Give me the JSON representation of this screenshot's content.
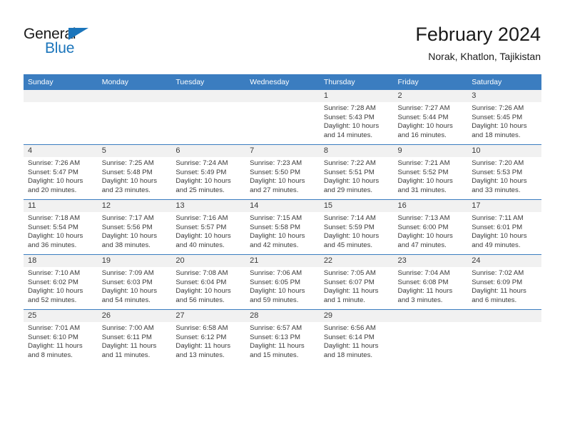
{
  "brand": {
    "name_top": "General",
    "name_bottom": "Blue",
    "triangle_icon": "triangle-icon",
    "accent_color": "#1b75bb"
  },
  "header": {
    "title": "February 2024",
    "subtitle": "Norak, Khatlon, Tajikistan"
  },
  "theme": {
    "header_blue": "#3b7dc0",
    "day_band_gray": "#f1f1f1",
    "text_color": "#3a3a3a"
  },
  "weekday_headers": [
    "Sunday",
    "Monday",
    "Tuesday",
    "Wednesday",
    "Thursday",
    "Friday",
    "Saturday"
  ],
  "weeks": [
    [
      {
        "day": "",
        "sunrise": "",
        "sunset": "",
        "daylight_line1": "",
        "daylight_line2": ""
      },
      {
        "day": "",
        "sunrise": "",
        "sunset": "",
        "daylight_line1": "",
        "daylight_line2": ""
      },
      {
        "day": "",
        "sunrise": "",
        "sunset": "",
        "daylight_line1": "",
        "daylight_line2": ""
      },
      {
        "day": "",
        "sunrise": "",
        "sunset": "",
        "daylight_line1": "",
        "daylight_line2": ""
      },
      {
        "day": "1",
        "sunrise": "Sunrise: 7:28 AM",
        "sunset": "Sunset: 5:43 PM",
        "daylight_line1": "Daylight: 10 hours",
        "daylight_line2": "and 14 minutes."
      },
      {
        "day": "2",
        "sunrise": "Sunrise: 7:27 AM",
        "sunset": "Sunset: 5:44 PM",
        "daylight_line1": "Daylight: 10 hours",
        "daylight_line2": "and 16 minutes."
      },
      {
        "day": "3",
        "sunrise": "Sunrise: 7:26 AM",
        "sunset": "Sunset: 5:45 PM",
        "daylight_line1": "Daylight: 10 hours",
        "daylight_line2": "and 18 minutes."
      }
    ],
    [
      {
        "day": "4",
        "sunrise": "Sunrise: 7:26 AM",
        "sunset": "Sunset: 5:47 PM",
        "daylight_line1": "Daylight: 10 hours",
        "daylight_line2": "and 20 minutes."
      },
      {
        "day": "5",
        "sunrise": "Sunrise: 7:25 AM",
        "sunset": "Sunset: 5:48 PM",
        "daylight_line1": "Daylight: 10 hours",
        "daylight_line2": "and 23 minutes."
      },
      {
        "day": "6",
        "sunrise": "Sunrise: 7:24 AM",
        "sunset": "Sunset: 5:49 PM",
        "daylight_line1": "Daylight: 10 hours",
        "daylight_line2": "and 25 minutes."
      },
      {
        "day": "7",
        "sunrise": "Sunrise: 7:23 AM",
        "sunset": "Sunset: 5:50 PM",
        "daylight_line1": "Daylight: 10 hours",
        "daylight_line2": "and 27 minutes."
      },
      {
        "day": "8",
        "sunrise": "Sunrise: 7:22 AM",
        "sunset": "Sunset: 5:51 PM",
        "daylight_line1": "Daylight: 10 hours",
        "daylight_line2": "and 29 minutes."
      },
      {
        "day": "9",
        "sunrise": "Sunrise: 7:21 AM",
        "sunset": "Sunset: 5:52 PM",
        "daylight_line1": "Daylight: 10 hours",
        "daylight_line2": "and 31 minutes."
      },
      {
        "day": "10",
        "sunrise": "Sunrise: 7:20 AM",
        "sunset": "Sunset: 5:53 PM",
        "daylight_line1": "Daylight: 10 hours",
        "daylight_line2": "and 33 minutes."
      }
    ],
    [
      {
        "day": "11",
        "sunrise": "Sunrise: 7:18 AM",
        "sunset": "Sunset: 5:54 PM",
        "daylight_line1": "Daylight: 10 hours",
        "daylight_line2": "and 36 minutes."
      },
      {
        "day": "12",
        "sunrise": "Sunrise: 7:17 AM",
        "sunset": "Sunset: 5:56 PM",
        "daylight_line1": "Daylight: 10 hours",
        "daylight_line2": "and 38 minutes."
      },
      {
        "day": "13",
        "sunrise": "Sunrise: 7:16 AM",
        "sunset": "Sunset: 5:57 PM",
        "daylight_line1": "Daylight: 10 hours",
        "daylight_line2": "and 40 minutes."
      },
      {
        "day": "14",
        "sunrise": "Sunrise: 7:15 AM",
        "sunset": "Sunset: 5:58 PM",
        "daylight_line1": "Daylight: 10 hours",
        "daylight_line2": "and 42 minutes."
      },
      {
        "day": "15",
        "sunrise": "Sunrise: 7:14 AM",
        "sunset": "Sunset: 5:59 PM",
        "daylight_line1": "Daylight: 10 hours",
        "daylight_line2": "and 45 minutes."
      },
      {
        "day": "16",
        "sunrise": "Sunrise: 7:13 AM",
        "sunset": "Sunset: 6:00 PM",
        "daylight_line1": "Daylight: 10 hours",
        "daylight_line2": "and 47 minutes."
      },
      {
        "day": "17",
        "sunrise": "Sunrise: 7:11 AM",
        "sunset": "Sunset: 6:01 PM",
        "daylight_line1": "Daylight: 10 hours",
        "daylight_line2": "and 49 minutes."
      }
    ],
    [
      {
        "day": "18",
        "sunrise": "Sunrise: 7:10 AM",
        "sunset": "Sunset: 6:02 PM",
        "daylight_line1": "Daylight: 10 hours",
        "daylight_line2": "and 52 minutes."
      },
      {
        "day": "19",
        "sunrise": "Sunrise: 7:09 AM",
        "sunset": "Sunset: 6:03 PM",
        "daylight_line1": "Daylight: 10 hours",
        "daylight_line2": "and 54 minutes."
      },
      {
        "day": "20",
        "sunrise": "Sunrise: 7:08 AM",
        "sunset": "Sunset: 6:04 PM",
        "daylight_line1": "Daylight: 10 hours",
        "daylight_line2": "and 56 minutes."
      },
      {
        "day": "21",
        "sunrise": "Sunrise: 7:06 AM",
        "sunset": "Sunset: 6:05 PM",
        "daylight_line1": "Daylight: 10 hours",
        "daylight_line2": "and 59 minutes."
      },
      {
        "day": "22",
        "sunrise": "Sunrise: 7:05 AM",
        "sunset": "Sunset: 6:07 PM",
        "daylight_line1": "Daylight: 11 hours",
        "daylight_line2": "and 1 minute."
      },
      {
        "day": "23",
        "sunrise": "Sunrise: 7:04 AM",
        "sunset": "Sunset: 6:08 PM",
        "daylight_line1": "Daylight: 11 hours",
        "daylight_line2": "and 3 minutes."
      },
      {
        "day": "24",
        "sunrise": "Sunrise: 7:02 AM",
        "sunset": "Sunset: 6:09 PM",
        "daylight_line1": "Daylight: 11 hours",
        "daylight_line2": "and 6 minutes."
      }
    ],
    [
      {
        "day": "25",
        "sunrise": "Sunrise: 7:01 AM",
        "sunset": "Sunset: 6:10 PM",
        "daylight_line1": "Daylight: 11 hours",
        "daylight_line2": "and 8 minutes."
      },
      {
        "day": "26",
        "sunrise": "Sunrise: 7:00 AM",
        "sunset": "Sunset: 6:11 PM",
        "daylight_line1": "Daylight: 11 hours",
        "daylight_line2": "and 11 minutes."
      },
      {
        "day": "27",
        "sunrise": "Sunrise: 6:58 AM",
        "sunset": "Sunset: 6:12 PM",
        "daylight_line1": "Daylight: 11 hours",
        "daylight_line2": "and 13 minutes."
      },
      {
        "day": "28",
        "sunrise": "Sunrise: 6:57 AM",
        "sunset": "Sunset: 6:13 PM",
        "daylight_line1": "Daylight: 11 hours",
        "daylight_line2": "and 15 minutes."
      },
      {
        "day": "29",
        "sunrise": "Sunrise: 6:56 AM",
        "sunset": "Sunset: 6:14 PM",
        "daylight_line1": "Daylight: 11 hours",
        "daylight_line2": "and 18 minutes."
      },
      {
        "day": "",
        "sunrise": "",
        "sunset": "",
        "daylight_line1": "",
        "daylight_line2": ""
      },
      {
        "day": "",
        "sunrise": "",
        "sunset": "",
        "daylight_line1": "",
        "daylight_line2": ""
      }
    ]
  ]
}
